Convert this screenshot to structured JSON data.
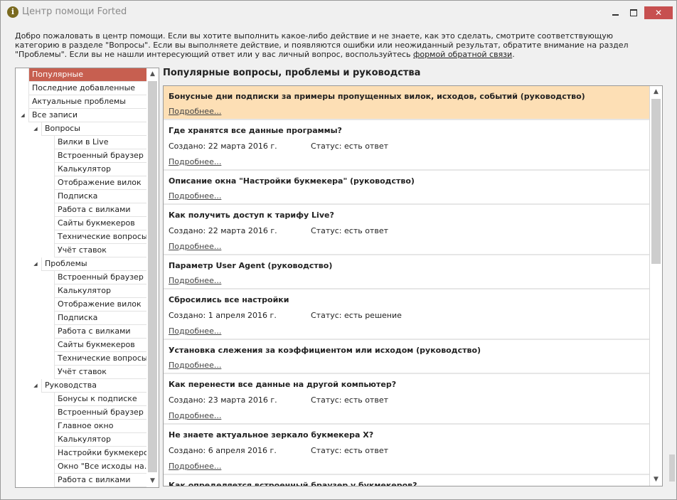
{
  "window": {
    "title": "Центр помощи Forted",
    "icon_glyph": "i",
    "minimize": "minimize",
    "maximize": "maximize",
    "close_glyph": "✕"
  },
  "intro": {
    "text_before_link": "Добро пожаловать в центр помощи. Если вы хотите выполнить какое-либо действие и не знаете, как это сделать, смотрите соответствующую категорию в разделе \"Вопросы\". Если вы выполняете действие, и появляются ошибки или неожиданный результат, обратите внимание на раздел \"Проблемы\". Если вы не нашли интересующий ответ или у вас личный вопрос, воспользуйтесь ",
    "link_text": "формой обратной связи",
    "text_after_link": "."
  },
  "tree": {
    "items": [
      {
        "label": "Популярные",
        "selected": true
      },
      {
        "label": "Последние добавленные"
      },
      {
        "label": "Актуальные проблемы"
      },
      {
        "label": "Все записи",
        "expander": "◢"
      },
      {
        "label": "Вопросы",
        "expander": "◢"
      },
      {
        "label": "Вилки в Live"
      },
      {
        "label": "Встроенный браузер"
      },
      {
        "label": "Калькулятор"
      },
      {
        "label": "Отображение вилок"
      },
      {
        "label": "Подписка"
      },
      {
        "label": "Работа с вилками"
      },
      {
        "label": "Сайты букмекеров"
      },
      {
        "label": "Технические вопросы"
      },
      {
        "label": "Учёт ставок"
      },
      {
        "label": "Проблемы",
        "expander": "◢"
      },
      {
        "label": "Встроенный браузер"
      },
      {
        "label": "Калькулятор"
      },
      {
        "label": "Отображение вилок"
      },
      {
        "label": "Подписка"
      },
      {
        "label": "Работа с вилками"
      },
      {
        "label": "Сайты букмекеров"
      },
      {
        "label": "Технические вопросы"
      },
      {
        "label": "Учёт ставок"
      },
      {
        "label": "Руководства",
        "expander": "◢"
      },
      {
        "label": "Бонусы к подписке"
      },
      {
        "label": "Встроенный браузер"
      },
      {
        "label": "Главное окно"
      },
      {
        "label": "Калькулятор"
      },
      {
        "label": "Настройки букмекеров"
      },
      {
        "label": "Окно \"Все исходы на..."
      },
      {
        "label": "Работа с вилками"
      }
    ],
    "scroll_up": "▲",
    "scroll_down": "▼"
  },
  "main": {
    "section_title": "Популярные вопросы, проблемы и руководства",
    "scroll_up": "▲",
    "scroll_down": "▼",
    "cards": [
      {
        "title": "Бонусные дни подписки за примеры пропущенных вилок, исходов, событий (руководство)",
        "link": "Подробнее...",
        "highlight": true
      },
      {
        "title": "Где хранятся все данные программы?",
        "created": "Создано:  22 марта 2016 г.",
        "status": "Статус:  есть ответ",
        "link": "Подробнее..."
      },
      {
        "title": "Описание окна \"Настройки букмекера\" (руководство)",
        "link": "Подробнее..."
      },
      {
        "title": "Как получить доступ к тарифу Live?",
        "created": "Создано:  22 марта 2016 г.",
        "status": "Статус:  есть ответ",
        "link": "Подробнее..."
      },
      {
        "title": "Параметр User Agent (руководство)",
        "link": "Подробнее..."
      },
      {
        "title": "Сбросились все настройки",
        "created": "Создано:  1 апреля 2016 г.",
        "status": "Статус:  есть решение",
        "link": "Подробнее..."
      },
      {
        "title": "Установка слежения за коэффициентом или исходом (руководство)",
        "link": "Подробнее..."
      },
      {
        "title": "Как перенести все данные на другой компьютер?",
        "created": "Создано:  23 марта 2016 г.",
        "status": "Статус:  есть ответ",
        "link": "Подробнее..."
      },
      {
        "title": "Не знаете актуальное зеркало букмекера X?",
        "created": "Создано:  6 апреля 2016 г.",
        "status": "Статус:  есть ответ",
        "link": "Подробнее..."
      },
      {
        "title": "Как определяется встроенный браузер у букмекеров?",
        "link": ""
      }
    ]
  }
}
